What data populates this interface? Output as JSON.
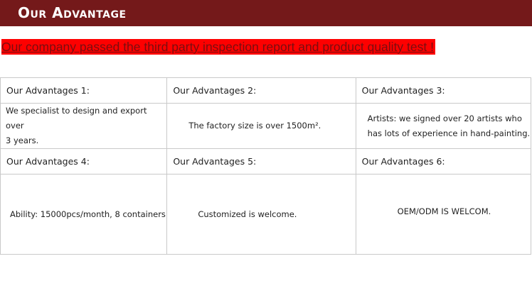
{
  "header": {
    "title": "Our Advantage",
    "background": "#74191a"
  },
  "notice": {
    "text": "Our company passed the third party inspection report and product quality test !",
    "highlight_color": "#fe0000",
    "text_color": "#7a0e10"
  },
  "advantages": [
    {
      "heading": "Our Advantages 1:",
      "lines": [
        "We specialist to design and export over",
        "3 years."
      ]
    },
    {
      "heading": "Our Advantages 2:",
      "lines": [
        "The factory size is over 1500m²."
      ]
    },
    {
      "heading": "Our Advantages 3:",
      "lines": [
        "Artists: we signed over 20 artists who",
        "has  lots of experience in hand-painting."
      ]
    },
    {
      "heading": "Our Advantages 4:",
      "lines": [
        "Ability: 15000pcs/month, 8 containers"
      ]
    },
    {
      "heading": "Our Advantages 5:",
      "lines": [
        "Customized is welcome."
      ]
    },
    {
      "heading": "Our Advantages 6:",
      "lines": [
        "OEM/ODM IS WELCOM."
      ]
    }
  ]
}
